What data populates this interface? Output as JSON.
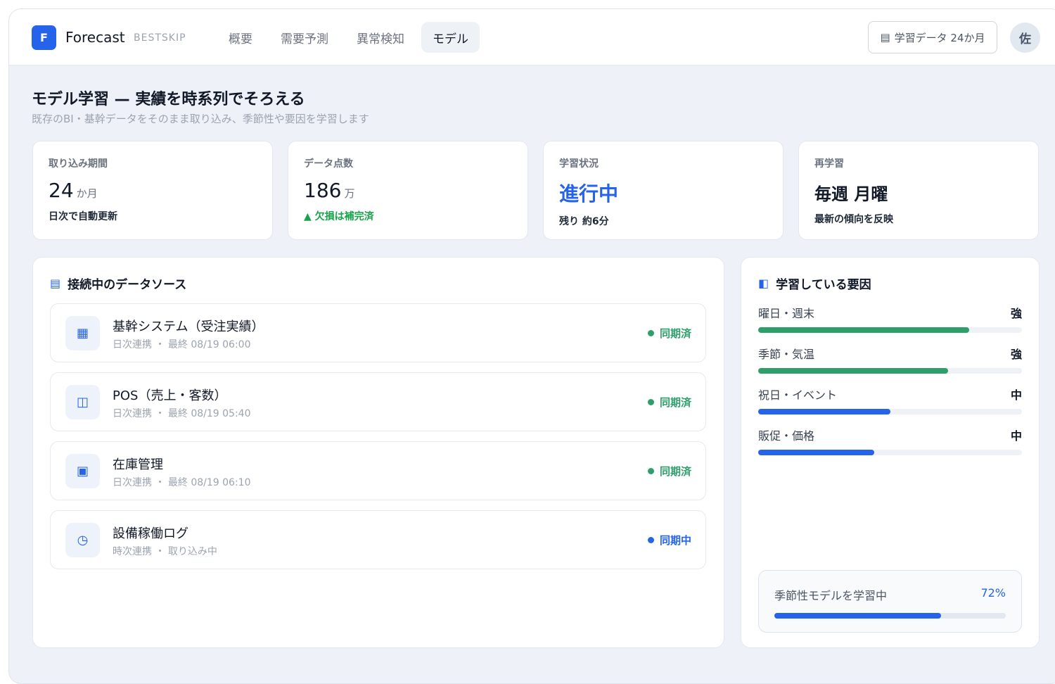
{
  "header": {
    "logo_letter": "F",
    "brand": "Forecast",
    "brand_sub": "BESTSKIP",
    "nav": [
      "概要",
      "需要予測",
      "異常検知",
      "モデル"
    ],
    "active_nav": 3,
    "data_button": "学習データ 24か月",
    "avatar": "佐"
  },
  "page": {
    "title": "モデル学習 — 実績を時系列でそろえる",
    "subtitle": "既存のBI・基幹データをそのまま取り込み、季節性や要因を学習します"
  },
  "stats": [
    {
      "label": "取り込み期間",
      "value": "24",
      "unit": "か月",
      "note": "日次で自動更新"
    },
    {
      "label": "データ点数",
      "value": "186",
      "unit": "万",
      "note": "▲ 欠損は補完済"
    },
    {
      "label": "学習状況",
      "value": "進行中",
      "unit": "",
      "note": "残り 約6分"
    },
    {
      "label": "再学習",
      "value": "毎週 月曜",
      "unit": "",
      "note": "最新の傾向を反映"
    }
  ],
  "datasources": {
    "title": "接続中のデータソース",
    "items": [
      {
        "icon": "grid-icon",
        "glyph": "▦",
        "name": "基幹システム（受注実績）",
        "meta": "日次連携 ・ 最終 08/19 06:00",
        "status": "同期済",
        "status_color": "#16a34a"
      },
      {
        "icon": "columns-icon",
        "glyph": "◫",
        "name": "POS（売上・客数）",
        "meta": "日次連携 ・ 最終 08/19 05:40",
        "status": "同期済",
        "status_color": "#16a34a"
      },
      {
        "icon": "box-icon",
        "glyph": "▣",
        "name": "在庫管理",
        "meta": "日次連携 ・ 最終 08/19 06:10",
        "status": "同期済",
        "status_color": "#16a34a"
      },
      {
        "icon": "clock-icon",
        "glyph": "◷",
        "name": "設備稼働ログ",
        "meta": "時次連携 ・ 取り込み中",
        "status": "同期中",
        "status_color": "#2563eb"
      }
    ]
  },
  "factors": {
    "title": "学習している要因",
    "items": [
      {
        "name": "曜日・週末",
        "level": "強",
        "fill": 0.8,
        "color": "#2e9e6b"
      },
      {
        "name": "季節・気温",
        "level": "強",
        "fill": 0.72,
        "color": "#2e9e6b"
      },
      {
        "name": "祝日・イベント",
        "level": "中",
        "fill": 0.5,
        "color": "#2563eb"
      },
      {
        "name": "販促・価格",
        "level": "中",
        "fill": 0.44,
        "color": "#2563eb"
      }
    ],
    "progress_label": "季節性モデルを学習中",
    "progress_pct": "72%",
    "progress_value": 0.72
  },
  "colors": {
    "accent": "#2563eb",
    "success": "#16a34a",
    "factor_green": "#2e9e6b"
  }
}
